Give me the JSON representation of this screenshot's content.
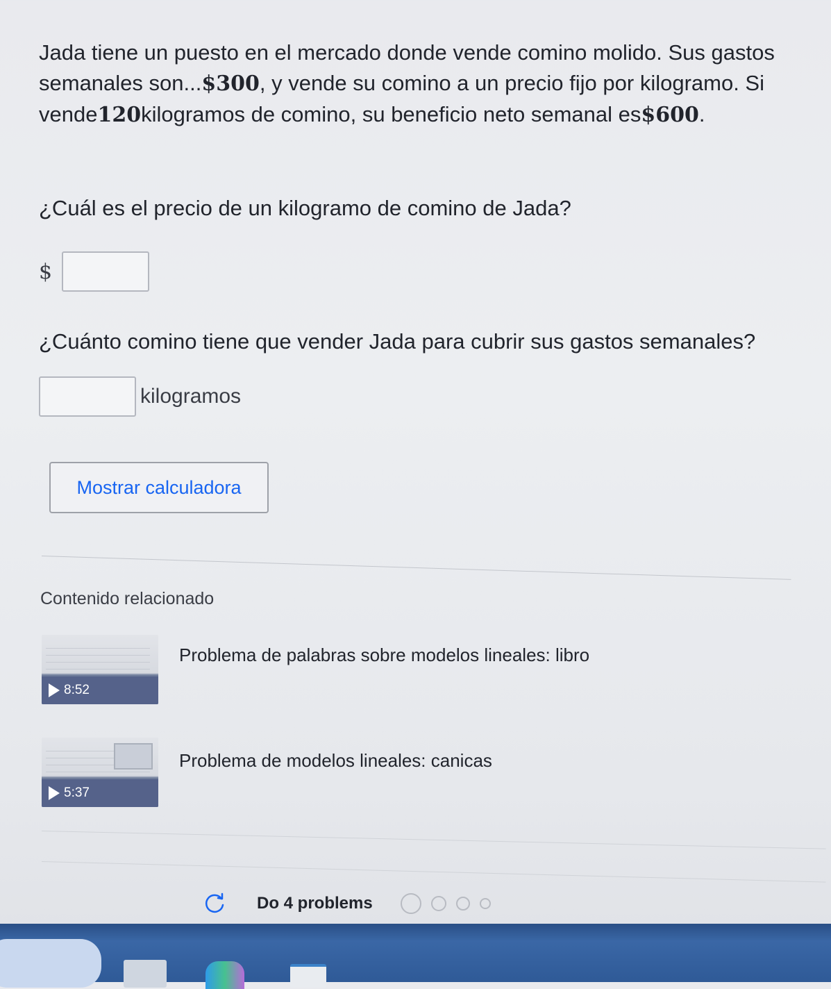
{
  "problem": {
    "text_part1": "Jada tiene un puesto en el mercado donde vende comino molido. Sus gastos semanales son...",
    "expenses": "$300",
    "text_part2": ", y vende su comino a un precio fijo por kilogramo. Si vende",
    "kilograms": "120",
    "text_part3": "kilogramos de comino, su beneficio neto semanal es",
    "profit": "$600",
    "text_part4": "."
  },
  "question1": {
    "text": "¿Cuál es el precio de un kilogramo de comino de Jada?",
    "prefix": "$",
    "answer_value": ""
  },
  "question2": {
    "text": "¿Cuánto comino tiene que vender Jada para cubrir sus gastos semanales?",
    "unit": "kilogramos",
    "answer_value": ""
  },
  "calculator_button": {
    "label": "Mostrar calculadora"
  },
  "related": {
    "heading": "Contenido relacionado",
    "videos": [
      {
        "title": "Problema de palabras sobre modelos lineales: libro",
        "duration": "8:52"
      },
      {
        "title": "Problema de modelos lineales: canicas",
        "duration": "5:37"
      }
    ]
  },
  "progress": {
    "label": "Do 4 problems",
    "icon": "restart-icon",
    "dots_count": 4
  },
  "colors": {
    "link_blue": "#1865f2",
    "text": "#21242c",
    "taskbar": "#2f5a97",
    "thumb_bar": "#55628a"
  }
}
